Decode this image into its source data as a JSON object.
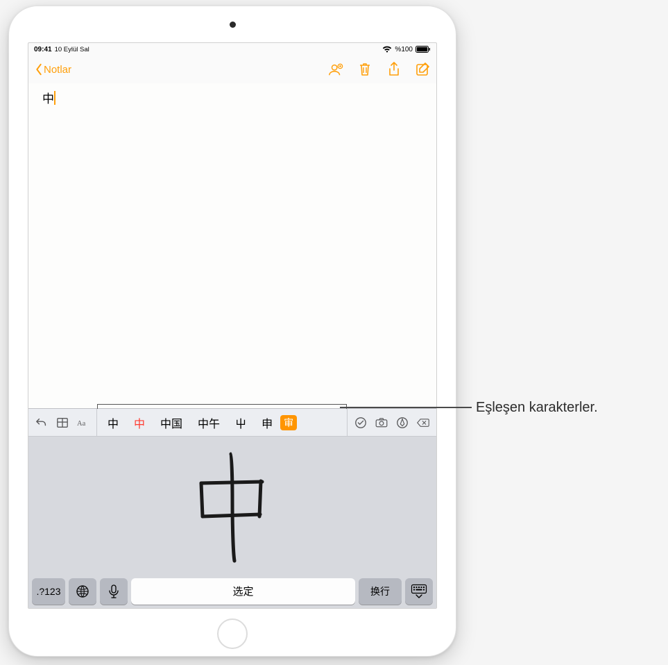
{
  "status": {
    "time": "09:41",
    "date": "10 Eylül Sal",
    "battery": "%100",
    "wifi_icon": "wifi"
  },
  "nav": {
    "back_label": "Notlar"
  },
  "note": {
    "typed": "中"
  },
  "candidate_bar": {
    "candidates": [
      "中",
      "中",
      "中国",
      "中午",
      "屮",
      "申",
      "审"
    ]
  },
  "keyboard": {
    "modifier_label": ".?123",
    "space_label": "选定",
    "enter_label": "换行"
  },
  "callout": {
    "label": "Eşleşen karakterler."
  }
}
